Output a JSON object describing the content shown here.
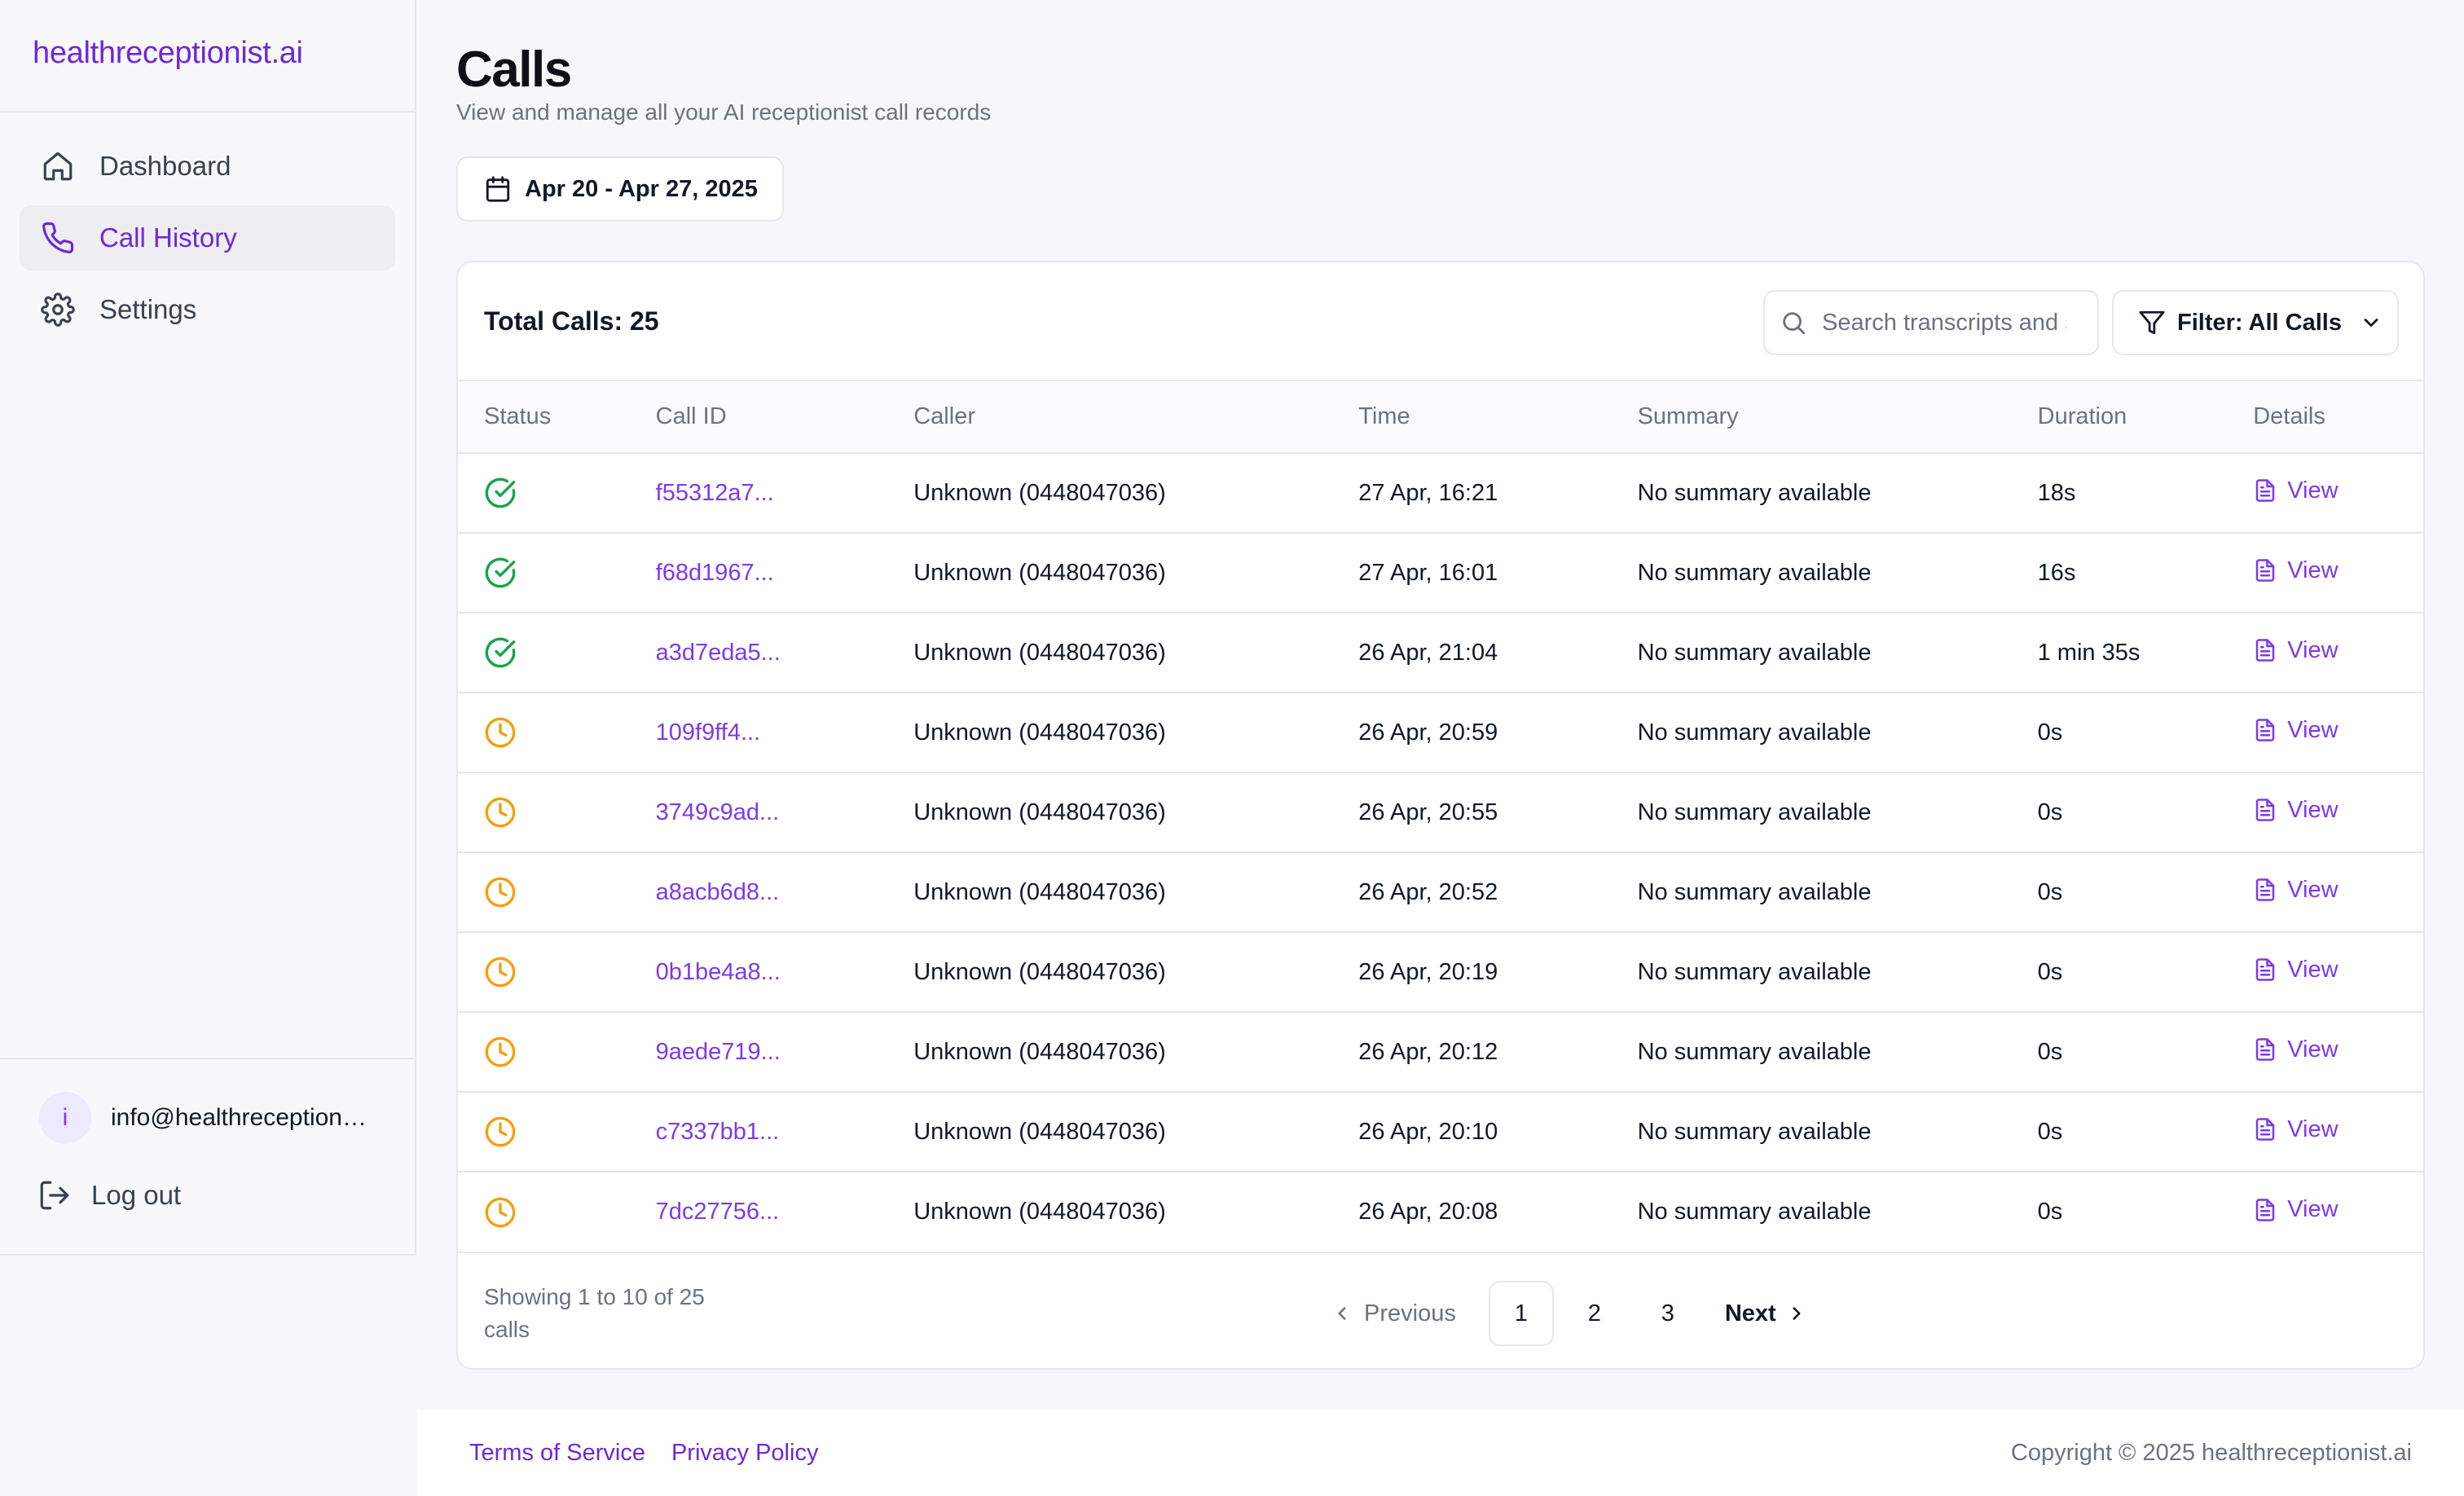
{
  "brand": "healthreceptionist.ai",
  "sidebar": {
    "items": [
      {
        "label": "Dashboard",
        "icon": "home-icon",
        "active": false
      },
      {
        "label": "Call History",
        "icon": "phone-icon",
        "active": true
      },
      {
        "label": "Settings",
        "icon": "gear-icon",
        "active": false
      }
    ],
    "user": {
      "avatar_letter": "i",
      "email": "info@healthreceptionist.ai"
    },
    "logout_label": "Log out"
  },
  "page": {
    "title": "Calls",
    "subtitle": "View and manage all your AI receptionist call records",
    "date_range": "Apr 20 - Apr 27, 2025"
  },
  "calls_card": {
    "total_label": "Total Calls: 25",
    "search_placeholder": "Search transcripts and summaries",
    "filter_label": "Filter: All Calls",
    "columns": [
      "Status",
      "Call ID",
      "Caller",
      "Time",
      "Summary",
      "Duration",
      "Details"
    ],
    "rows": [
      {
        "status": "completed",
        "call_id": "f55312a7...",
        "caller": "Unknown (0448047036)",
        "time": "27 Apr, 16:21",
        "summary": "No summary available",
        "duration": "18s",
        "details": "View"
      },
      {
        "status": "completed",
        "call_id": "f68d1967...",
        "caller": "Unknown (0448047036)",
        "time": "27 Apr, 16:01",
        "summary": "No summary available",
        "duration": "16s",
        "details": "View"
      },
      {
        "status": "completed",
        "call_id": "a3d7eda5...",
        "caller": "Unknown (0448047036)",
        "time": "26 Apr, 21:04",
        "summary": "No summary available",
        "duration": "1 min 35s",
        "details": "View"
      },
      {
        "status": "pending",
        "call_id": "109f9ff4...",
        "caller": "Unknown (0448047036)",
        "time": "26 Apr, 20:59",
        "summary": "No summary available",
        "duration": "0s",
        "details": "View"
      },
      {
        "status": "pending",
        "call_id": "3749c9ad...",
        "caller": "Unknown (0448047036)",
        "time": "26 Apr, 20:55",
        "summary": "No summary available",
        "duration": "0s",
        "details": "View"
      },
      {
        "status": "pending",
        "call_id": "a8acb6d8...",
        "caller": "Unknown (0448047036)",
        "time": "26 Apr, 20:52",
        "summary": "No summary available",
        "duration": "0s",
        "details": "View"
      },
      {
        "status": "pending",
        "call_id": "0b1be4a8...",
        "caller": "Unknown (0448047036)",
        "time": "26 Apr, 20:19",
        "summary": "No summary available",
        "duration": "0s",
        "details": "View"
      },
      {
        "status": "pending",
        "call_id": "9aede719...",
        "caller": "Unknown (0448047036)",
        "time": "26 Apr, 20:12",
        "summary": "No summary available",
        "duration": "0s",
        "details": "View"
      },
      {
        "status": "pending",
        "call_id": "c7337bb1...",
        "caller": "Unknown (0448047036)",
        "time": "26 Apr, 20:10",
        "summary": "No summary available",
        "duration": "0s",
        "details": "View"
      },
      {
        "status": "pending",
        "call_id": "7dc27756...",
        "caller": "Unknown (0448047036)",
        "time": "26 Apr, 20:08",
        "summary": "No summary available",
        "duration": "0s",
        "details": "View"
      }
    ],
    "showing_text": "Showing 1 to 10 of 25 calls",
    "pagination": {
      "previous": "Previous",
      "next": "Next",
      "pages": [
        "1",
        "2",
        "3"
      ],
      "current": "1"
    }
  },
  "footer": {
    "terms": "Terms of Service",
    "privacy": "Privacy Policy",
    "copyright": "Copyright © 2025 healthreceptionist.ai"
  },
  "colors": {
    "accent": "#7c3aed",
    "completed": "#16a34a",
    "pending": "#f59e0b"
  }
}
